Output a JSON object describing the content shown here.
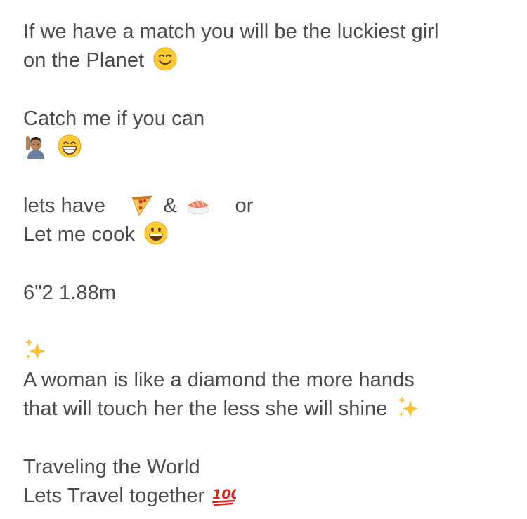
{
  "bio": {
    "line1": "If we have a match you will be the luckiest girl",
    "line2": "on the Planet",
    "line3": "Catch me if you can",
    "line4_icons": [
      "person-raising-hand-icon",
      "grinning-face-icon"
    ],
    "line5_a": "lets have",
    "line5_amp": "&",
    "line5_b": "or",
    "line6": "Let me cook",
    "line7": "6\"2 1.88m",
    "line8_icons": [
      "sparkles-icon"
    ],
    "line9": "A woman is like a diamond the more hands",
    "line10": "that will touch her the less she will shine",
    "line11": "Traveling the World",
    "line12": "Lets Travel together"
  },
  "colors": {
    "text": "#4a4a4a",
    "background": "#ffffff",
    "emoji_yellow": "#ffcc33",
    "sparkle": "#f5c33b",
    "hundred_red": "#e0241f"
  }
}
